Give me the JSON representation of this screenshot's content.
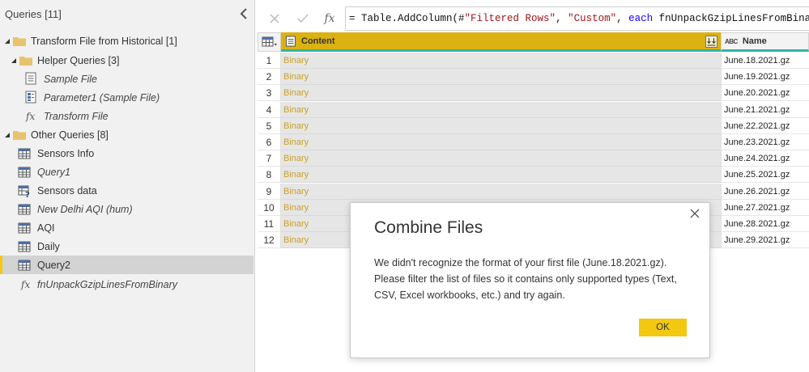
{
  "queries_pane": {
    "title": "Queries [11]",
    "groups": {
      "transform": "Transform File from Historical [1]",
      "helper": "Helper Queries [3]",
      "other": "Other Queries [8]"
    },
    "items": {
      "sample_file": "Sample File",
      "parameter1": "Parameter1 (Sample File)",
      "transform_file": "Transform File",
      "sensors_info": "Sensors Info",
      "query1": "Query1",
      "sensors_data": "Sensors data",
      "new_delhi": "New Delhi AQI (hum)",
      "aqi": "AQI",
      "daily": "Daily",
      "query2": "Query2",
      "fn_unpack": "fnUnpackGzipLinesFromBinary"
    }
  },
  "formula_bar": {
    "prefix": "= Table.AddColumn(#",
    "str1": "\"Filtered Rows\"",
    "comma1": ", ",
    "str2": "\"Custom\"",
    "comma2": ", ",
    "kw_each": "each",
    "suffix": " fnUnpackGzipLinesFromBinary([Folder"
  },
  "grid": {
    "content_header": "Content",
    "name_header": "Name",
    "name_type_badge": "ABC",
    "rows": [
      {
        "num": "1",
        "content": "Binary",
        "name": "June.18.2021.gz"
      },
      {
        "num": "2",
        "content": "Binary",
        "name": "June.19.2021.gz"
      },
      {
        "num": "3",
        "content": "Binary",
        "name": "June.20.2021.gz"
      },
      {
        "num": "4",
        "content": "Binary",
        "name": "June.21.2021.gz"
      },
      {
        "num": "5",
        "content": "Binary",
        "name": "June.22.2021.gz"
      },
      {
        "num": "6",
        "content": "Binary",
        "name": "June.23.2021.gz"
      },
      {
        "num": "7",
        "content": "Binary",
        "name": "June.24.2021.gz"
      },
      {
        "num": "8",
        "content": "Binary",
        "name": "June.25.2021.gz"
      },
      {
        "num": "9",
        "content": "Binary",
        "name": "June.26.2021.gz"
      },
      {
        "num": "10",
        "content": "Binary",
        "name": "June.27.2021.gz"
      },
      {
        "num": "11",
        "content": "Binary",
        "name": "June.28.2021.gz"
      },
      {
        "num": "12",
        "content": "Binary",
        "name": "June.29.2021.gz"
      }
    ]
  },
  "dialog": {
    "title": "Combine Files",
    "message": "We didn't recognize the format of your first file (June.18.2021.gz). Please filter the list of files so it contains only supported types (Text, CSV, Excel workbooks, etc.) and try again.",
    "ok_label": "OK"
  },
  "colors": {
    "accent_yellow": "#f2c811",
    "column_header": "#dcb112",
    "binary_text": "#c7a02e",
    "teal_underline": "#31b6a5"
  }
}
